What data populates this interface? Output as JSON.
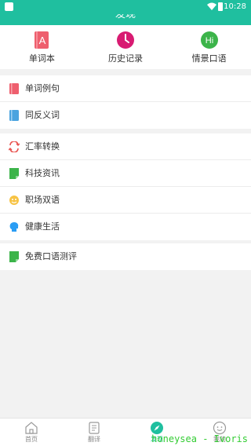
{
  "statusbar": {
    "time": "10:28"
  },
  "header": {
    "title": "发现"
  },
  "quick": [
    {
      "label": "单词本",
      "icon": "vocabulary-book-icon",
      "color": "#ee5f6e"
    },
    {
      "label": "历史记录",
      "icon": "clock-icon",
      "color": "#d81b72"
    },
    {
      "label": "情景口语",
      "icon": "hi-chat-icon",
      "color": "#3cb44a"
    }
  ],
  "group1": [
    {
      "label": "单词例句",
      "icon": "red-book-icon"
    },
    {
      "label": "同反义词",
      "icon": "blue-book-icon"
    }
  ],
  "group2": [
    {
      "label": "汇率转换",
      "icon": "exchange-icon"
    },
    {
      "label": "科技资讯",
      "icon": "green-note-icon"
    },
    {
      "label": "职场双语",
      "icon": "smile-face-icon"
    },
    {
      "label": "健康生活",
      "icon": "head-icon"
    }
  ],
  "group3": [
    {
      "label": "免费口语测评",
      "icon": "green-note-icon"
    }
  ],
  "tabs": [
    {
      "label": "首页",
      "icon": "home-icon"
    },
    {
      "label": "翻译",
      "icon": "translate-icon"
    },
    {
      "label": "发现",
      "icon": "compass-icon",
      "active": true
    },
    {
      "label": "我的",
      "icon": "user-face-icon"
    }
  ],
  "watermark": "honeysea - Ivoris",
  "colors": {
    "accent": "#1fbf9f"
  }
}
